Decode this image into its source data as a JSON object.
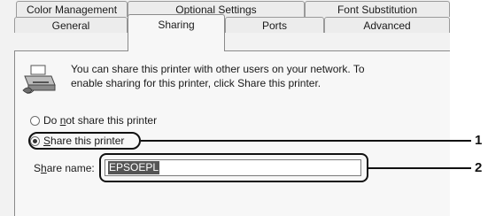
{
  "tabs_top": [
    {
      "label": "Color Management"
    },
    {
      "label": "Optional Settings"
    },
    {
      "label": "Font Substitution"
    }
  ],
  "tabs_bottom": [
    {
      "label": "General"
    },
    {
      "label": "Sharing",
      "active": true
    },
    {
      "label": "Ports"
    },
    {
      "label": "Advanced"
    }
  ],
  "description": {
    "line1": "You can share this printer with other users on your network.  To",
    "line2": "enable sharing for this printer, click Share this printer."
  },
  "radios": {
    "do_not_share": {
      "prefix": "Do ",
      "mnemonic": "n",
      "suffix": "ot share this printer",
      "checked": false
    },
    "share": {
      "prefix": "",
      "mnemonic": "S",
      "suffix": "hare this printer",
      "checked": true
    }
  },
  "share_name": {
    "label_prefix": "S",
    "label_mnemonic": "h",
    "label_suffix": "are name:",
    "value": "EPSOEPL"
  },
  "callouts": [
    "1",
    "2"
  ],
  "icons": {
    "printer": "printer-icon"
  }
}
